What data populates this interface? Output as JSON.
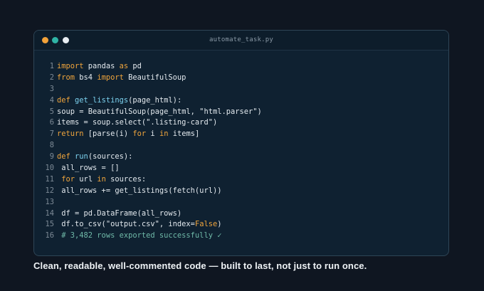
{
  "colors": {
    "background": "#0f1621",
    "window": "#0f2131",
    "dot_orange": "#f2a23a",
    "dot_teal": "#2fb4a6",
    "dot_white": "#e8edf2",
    "keyword": "#f0a53c",
    "function": "#7dd3f0",
    "comment": "#6fb9a8"
  },
  "window": {
    "filename": "automate_task.py",
    "controls": [
      "orange-dot",
      "teal-dot",
      "white-dot"
    ]
  },
  "code": {
    "lines": [
      {
        "n": "1",
        "tokens": [
          {
            "t": "import",
            "c": "kw"
          },
          {
            "t": " pandas "
          },
          {
            "t": "as",
            "c": "kw"
          },
          {
            "t": " pd"
          }
        ]
      },
      {
        "n": "2",
        "tokens": [
          {
            "t": "from",
            "c": "kw"
          },
          {
            "t": " bs4 "
          },
          {
            "t": "import",
            "c": "kw"
          },
          {
            "t": " BeautifulSoup"
          }
        ]
      },
      {
        "n": "3",
        "tokens": []
      },
      {
        "n": "4",
        "tokens": [
          {
            "t": "def",
            "c": "kw"
          },
          {
            "t": " "
          },
          {
            "t": "get_listings",
            "c": "fn"
          },
          {
            "t": "(page_html):"
          }
        ]
      },
      {
        "n": "5",
        "tokens": [
          {
            "t": "soup = BeautifulSoup(page_html, \"html.parser\")"
          }
        ]
      },
      {
        "n": "6",
        "tokens": [
          {
            "t": "items = soup.select(\".listing-card\")"
          }
        ]
      },
      {
        "n": "7",
        "tokens": [
          {
            "t": "return",
            "c": "kw"
          },
          {
            "t": " [parse(i) "
          },
          {
            "t": "for",
            "c": "kw"
          },
          {
            "t": " i "
          },
          {
            "t": "in",
            "c": "kw"
          },
          {
            "t": " items]"
          }
        ]
      },
      {
        "n": "8",
        "tokens": []
      },
      {
        "n": "9",
        "tokens": [
          {
            "t": "def",
            "c": "kw"
          },
          {
            "t": " "
          },
          {
            "t": "run",
            "c": "fn"
          },
          {
            "t": "(sources):"
          }
        ]
      },
      {
        "n": "10",
        "tokens": [
          {
            "t": " all_rows = []"
          }
        ]
      },
      {
        "n": "11",
        "tokens": [
          {
            "t": " "
          },
          {
            "t": "for",
            "c": "kw"
          },
          {
            "t": " url "
          },
          {
            "t": "in",
            "c": "kw"
          },
          {
            "t": " sources:"
          }
        ]
      },
      {
        "n": "12",
        "tokens": [
          {
            "t": " all_rows += get_listings(fetch(url))"
          }
        ]
      },
      {
        "n": "13",
        "tokens": []
      },
      {
        "n": "14",
        "tokens": [
          {
            "t": " df = pd.DataFrame(all_rows)"
          }
        ]
      },
      {
        "n": "15",
        "tokens": [
          {
            "t": " df.to_csv(\"output.csv\", index="
          },
          {
            "t": "False",
            "c": "const"
          },
          {
            "t": ")"
          }
        ]
      },
      {
        "n": "16",
        "tokens": [
          {
            "t": " # 3,482 rows exported successfully ✓",
            "c": "comment"
          }
        ]
      }
    ]
  },
  "caption": "Clean, readable, well-commented code — built to last, not just to run once."
}
